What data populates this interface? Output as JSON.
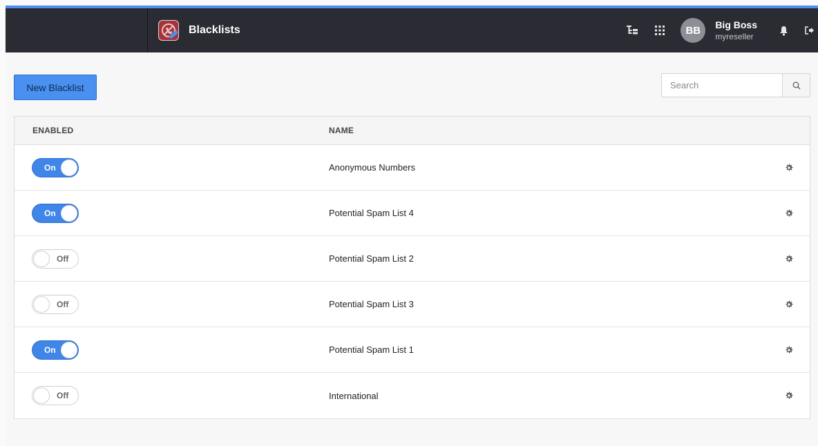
{
  "colors": {
    "topbar_bg": "#2b2b33",
    "accent": "#4a8ff0",
    "toggle_on": "#3f86e8",
    "button_primary": "#4a90f0"
  },
  "header": {
    "app_title": "Blacklists",
    "app_icon": "blocked-phone-icon",
    "user_initials": "BB",
    "user_name": "Big Boss",
    "user_sub": "myreseller",
    "icons": [
      "tree-icon",
      "apps-grid-icon",
      "bell-icon",
      "logout-icon"
    ]
  },
  "toolbar": {
    "new_button_label": "New Blacklist",
    "search_placeholder": "Search",
    "search_value": ""
  },
  "table": {
    "headers": {
      "enabled": "ENABLED",
      "name": "NAME"
    },
    "rows": [
      {
        "enabled": true,
        "toggle_label": "On",
        "name": "Anonymous Numbers"
      },
      {
        "enabled": true,
        "toggle_label": "On",
        "name": "Potential Spam List 4"
      },
      {
        "enabled": false,
        "toggle_label": "Off",
        "name": "Potential Spam List 2"
      },
      {
        "enabled": false,
        "toggle_label": "Off",
        "name": "Potential Spam List 3"
      },
      {
        "enabled": true,
        "toggle_label": "On",
        "name": "Potential Spam List 1"
      },
      {
        "enabled": false,
        "toggle_label": "Off",
        "name": "International"
      }
    ]
  }
}
